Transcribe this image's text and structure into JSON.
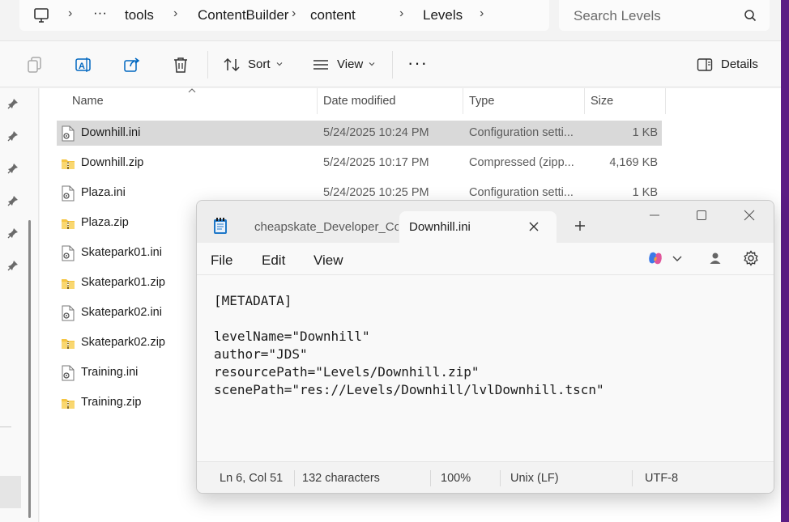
{
  "explorer": {
    "breadcrumb": {
      "more": "···",
      "items": [
        "tools",
        "ContentBuilder",
        "content",
        "Levels"
      ]
    },
    "search": {
      "placeholder": "Search Levels"
    },
    "command_bar": {
      "sort_label": "Sort",
      "view_label": "View",
      "more_label": "···",
      "details_label": "Details"
    },
    "columns": {
      "name": "Name",
      "date": "Date modified",
      "type": "Type",
      "size": "Size"
    },
    "files": [
      {
        "name": "Downhill.ini",
        "date": "5/24/2025 10:24 PM",
        "type": "Configuration setti...",
        "size": "1 KB",
        "icon": "config-file-icon",
        "selected": true
      },
      {
        "name": "Downhill.zip",
        "date": "5/24/2025 10:17 PM",
        "type": "Compressed (zipp...",
        "size": "4,169 KB",
        "icon": "zip-folder-icon"
      },
      {
        "name": "Plaza.ini",
        "date": "5/24/2025 10:25 PM",
        "type": "Configuration setti...",
        "size": "1 KB",
        "icon": "config-file-icon"
      },
      {
        "name": "Plaza.zip",
        "icon": "zip-folder-icon"
      },
      {
        "name": "Skatepark01.ini",
        "icon": "config-file-icon"
      },
      {
        "name": "Skatepark01.zip",
        "icon": "zip-folder-icon"
      },
      {
        "name": "Skatepark02.ini",
        "icon": "config-file-icon"
      },
      {
        "name": "Skatepark02.zip",
        "icon": "zip-folder-icon"
      },
      {
        "name": "Training.ini",
        "icon": "config-file-icon"
      },
      {
        "name": "Training.zip",
        "icon": "zip-folder-icon"
      }
    ]
  },
  "notepad": {
    "tabs": [
      {
        "label": "cheapskate_Developer_Co",
        "active": false
      },
      {
        "label": "Downhill.ini",
        "active": true
      }
    ],
    "menu": {
      "file": "File",
      "edit": "Edit",
      "view": "View"
    },
    "content_lines": [
      "[METADATA]",
      "",
      "levelName=\"Downhill\"",
      "author=\"JDS\"",
      "resourcePath=\"Levels/Downhill.zip\"",
      "scenePath=\"res://Levels/Downhill/lvlDownhill.tscn\""
    ],
    "status": {
      "position": "Ln 6, Col 51",
      "characters": "132 characters",
      "zoom": "100%",
      "line_ending": "Unix (LF)",
      "encoding": "UTF-8"
    }
  },
  "colors": {
    "accent_strip": "#5b1d84",
    "selected_row": "#d9d9d9",
    "share_blue": "#0067c0"
  }
}
